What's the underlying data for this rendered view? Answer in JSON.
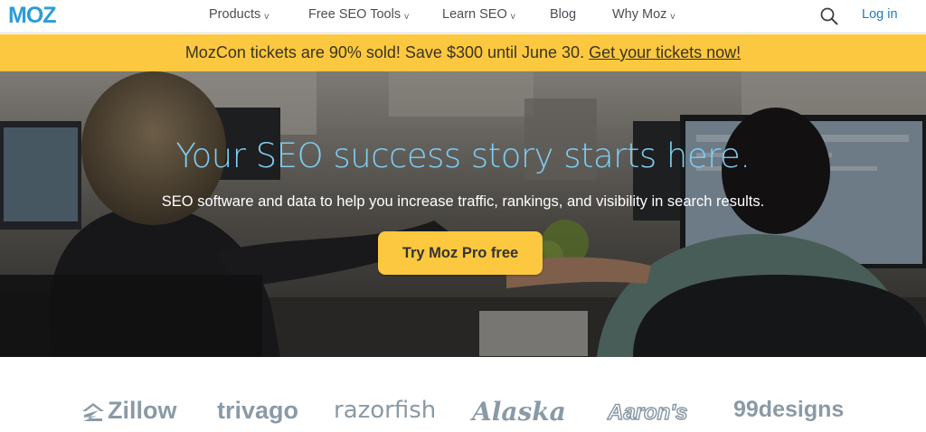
{
  "header": {
    "logo": "MOZ",
    "nav": [
      {
        "label": "Products",
        "has_dropdown": true
      },
      {
        "label": "Free SEO Tools",
        "has_dropdown": true
      },
      {
        "label": "Learn SEO",
        "has_dropdown": true
      },
      {
        "label": "Blog",
        "has_dropdown": false
      },
      {
        "label": "Why Moz",
        "has_dropdown": true
      }
    ],
    "chevron": "v",
    "search_icon": "search-icon",
    "login": "Log in"
  },
  "banner": {
    "text": "MozCon tickets are 90% sold! Save $300 until June 30.",
    "link": "Get your tickets now!"
  },
  "hero": {
    "title": "Your SEO success story starts here.",
    "subtitle": "SEO software and data to help you increase traffic, rankings, and visibility in search results.",
    "cta": "Try Moz Pro free"
  },
  "logos": [
    "Zillow",
    "trivago",
    "razorfish",
    "Alaska",
    "Aaron's",
    "99designs"
  ],
  "colors": {
    "brand_blue": "#2b9cd8",
    "banner_yellow": "#fcc83f",
    "hero_title": "#7fcdf3",
    "link_blue": "#1f7bc1",
    "logo_gray": "#8a9aa6"
  }
}
